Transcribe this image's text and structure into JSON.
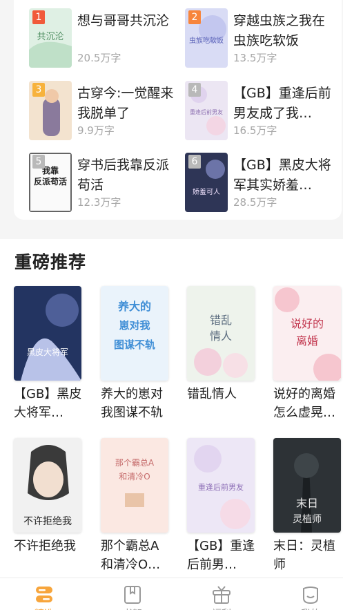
{
  "ranking": {
    "items": [
      {
        "rank": "1",
        "title": "想与哥哥共沉沦",
        "count": "20.5万字",
        "badge_color": "#f15a3a"
      },
      {
        "rank": "2",
        "title": "穿越虫族之我在虫族吃软饭",
        "count": "13.5万字",
        "badge_color": "#f7853c"
      },
      {
        "rank": "3",
        "title": "古穿今:一觉醒来我脱单了",
        "count": "9.9万字",
        "badge_color": "#f7b23c"
      },
      {
        "rank": "4",
        "title": "【GB】重逢后前男友成了我…",
        "count": "16.5万字",
        "badge_color": "#b9b9b9"
      },
      {
        "rank": "5",
        "title": "穿书后我靠反派苟活",
        "count": "12.3万字",
        "badge_color": "#b9b9b9"
      },
      {
        "rank": "6",
        "title": "【GB】黑皮大将军其实娇羞…",
        "count": "28.5万字",
        "badge_color": "#b9b9b9"
      }
    ]
  },
  "recommend": {
    "title": "重磅推荐",
    "books": [
      {
        "title": "【GB】黑皮大将军…"
      },
      {
        "title": "养大的崽对我图谋不轨"
      },
      {
        "title": "错乱情人"
      },
      {
        "title": "说好的离婚怎么虚晃…"
      },
      {
        "title": "不许拒绝我"
      },
      {
        "title": "那个霸总A和清冷O…"
      },
      {
        "title": "【GB】重逢后前男…"
      },
      {
        "title": "末日：灵植师"
      }
    ]
  },
  "tabs": [
    {
      "label": "精选",
      "icon": "bookstore-icon",
      "active": true
    },
    {
      "label": "书架",
      "icon": "bookshelf-icon",
      "active": false
    },
    {
      "label": "福利",
      "icon": "gift-icon",
      "active": false
    },
    {
      "label": "我的",
      "icon": "profile-icon",
      "active": false
    }
  ],
  "colors": {
    "accent": "#f7a53c",
    "inactive": "#999999"
  }
}
